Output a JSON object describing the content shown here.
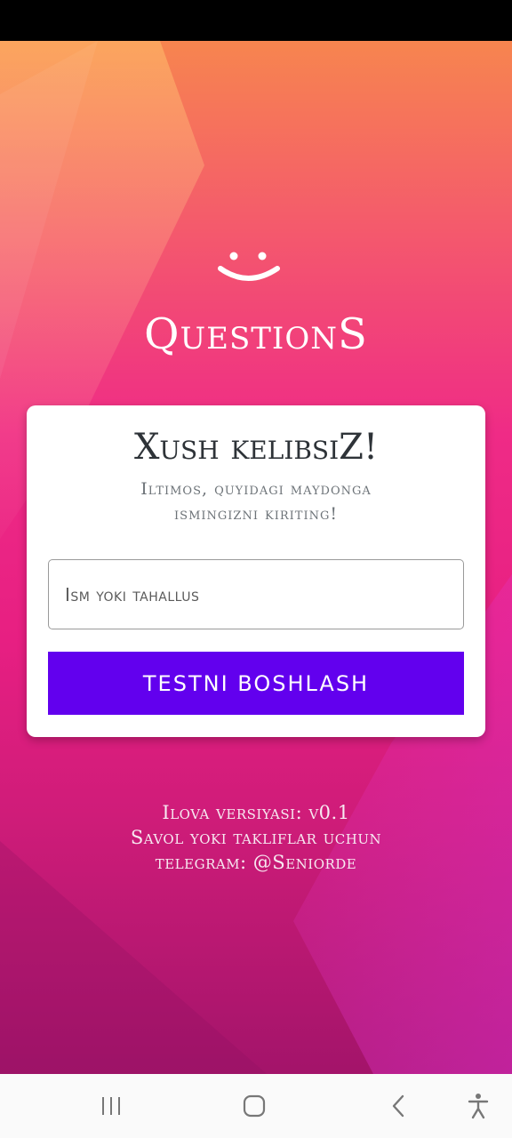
{
  "app": {
    "title": "QuestionS"
  },
  "welcome_card": {
    "heading": "Xush kelibsiZ!",
    "subtitle_line1": "Iltimos, quyidagi maydonga",
    "subtitle_line2": "ismingizni kiriting!",
    "name_input": {
      "placeholder": "Ism yoki tahallus",
      "value": ""
    },
    "start_button_label": "TESTNI BOSHLASH"
  },
  "footer": {
    "version_line": "Ilova versiyasi: v0.1",
    "contact_line1": "Savol yoki takliflar uchun",
    "contact_line2": "telegram: @Seniorde"
  },
  "icons": {
    "logo": "smiley-icon",
    "nav_recents": "recents-icon",
    "nav_home": "home-icon",
    "nav_back": "back-icon",
    "nav_accessibility": "accessibility-icon"
  },
  "colors": {
    "button": "#6200ee",
    "card": "#ffffff",
    "heading_text": "#2e3338"
  }
}
